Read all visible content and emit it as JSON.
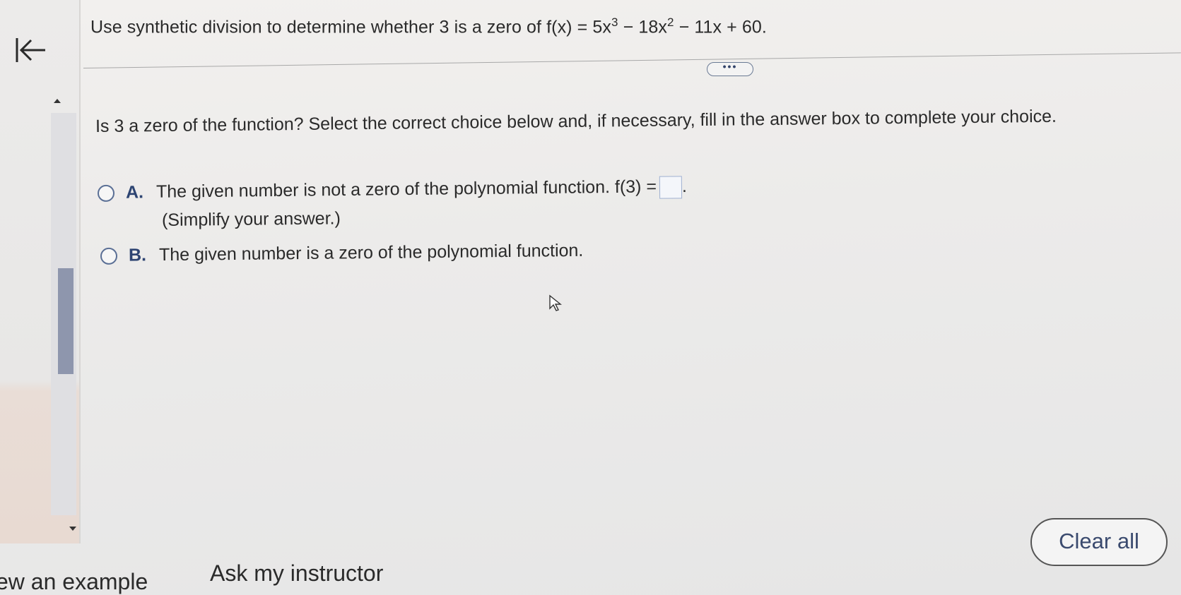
{
  "nav": {
    "collapse_icon": "collapse-left-arrow-icon"
  },
  "problem": {
    "statement_prefix": "Use synthetic division to determine whether 3 is a zero of f(x) = 5x",
    "exp1": "3",
    "mid": " − 18x",
    "exp2": "2",
    "suffix": " − 11x + 60."
  },
  "more_button_label": "•••",
  "question": {
    "prompt": "Is 3 a zero of the function? Select the correct choice below and, if necessary, fill in the answer box to complete your choice.",
    "choices": [
      {
        "letter": "A.",
        "text": "The given number is not a zero of the polynomial function. f(3) =",
        "answer_value": "",
        "after_box": ".",
        "note": "(Simplify your answer.)"
      },
      {
        "letter": "B.",
        "text": "The given number is a zero of the polynomial function."
      }
    ]
  },
  "footer": {
    "view_example": "ew an example",
    "ask_instructor": "Ask my instructor",
    "clear_all": "Clear all"
  },
  "colors": {
    "accent": "#2e4472",
    "radio_border": "#5a6f95",
    "scroll_thumb": "#8e96ad"
  }
}
